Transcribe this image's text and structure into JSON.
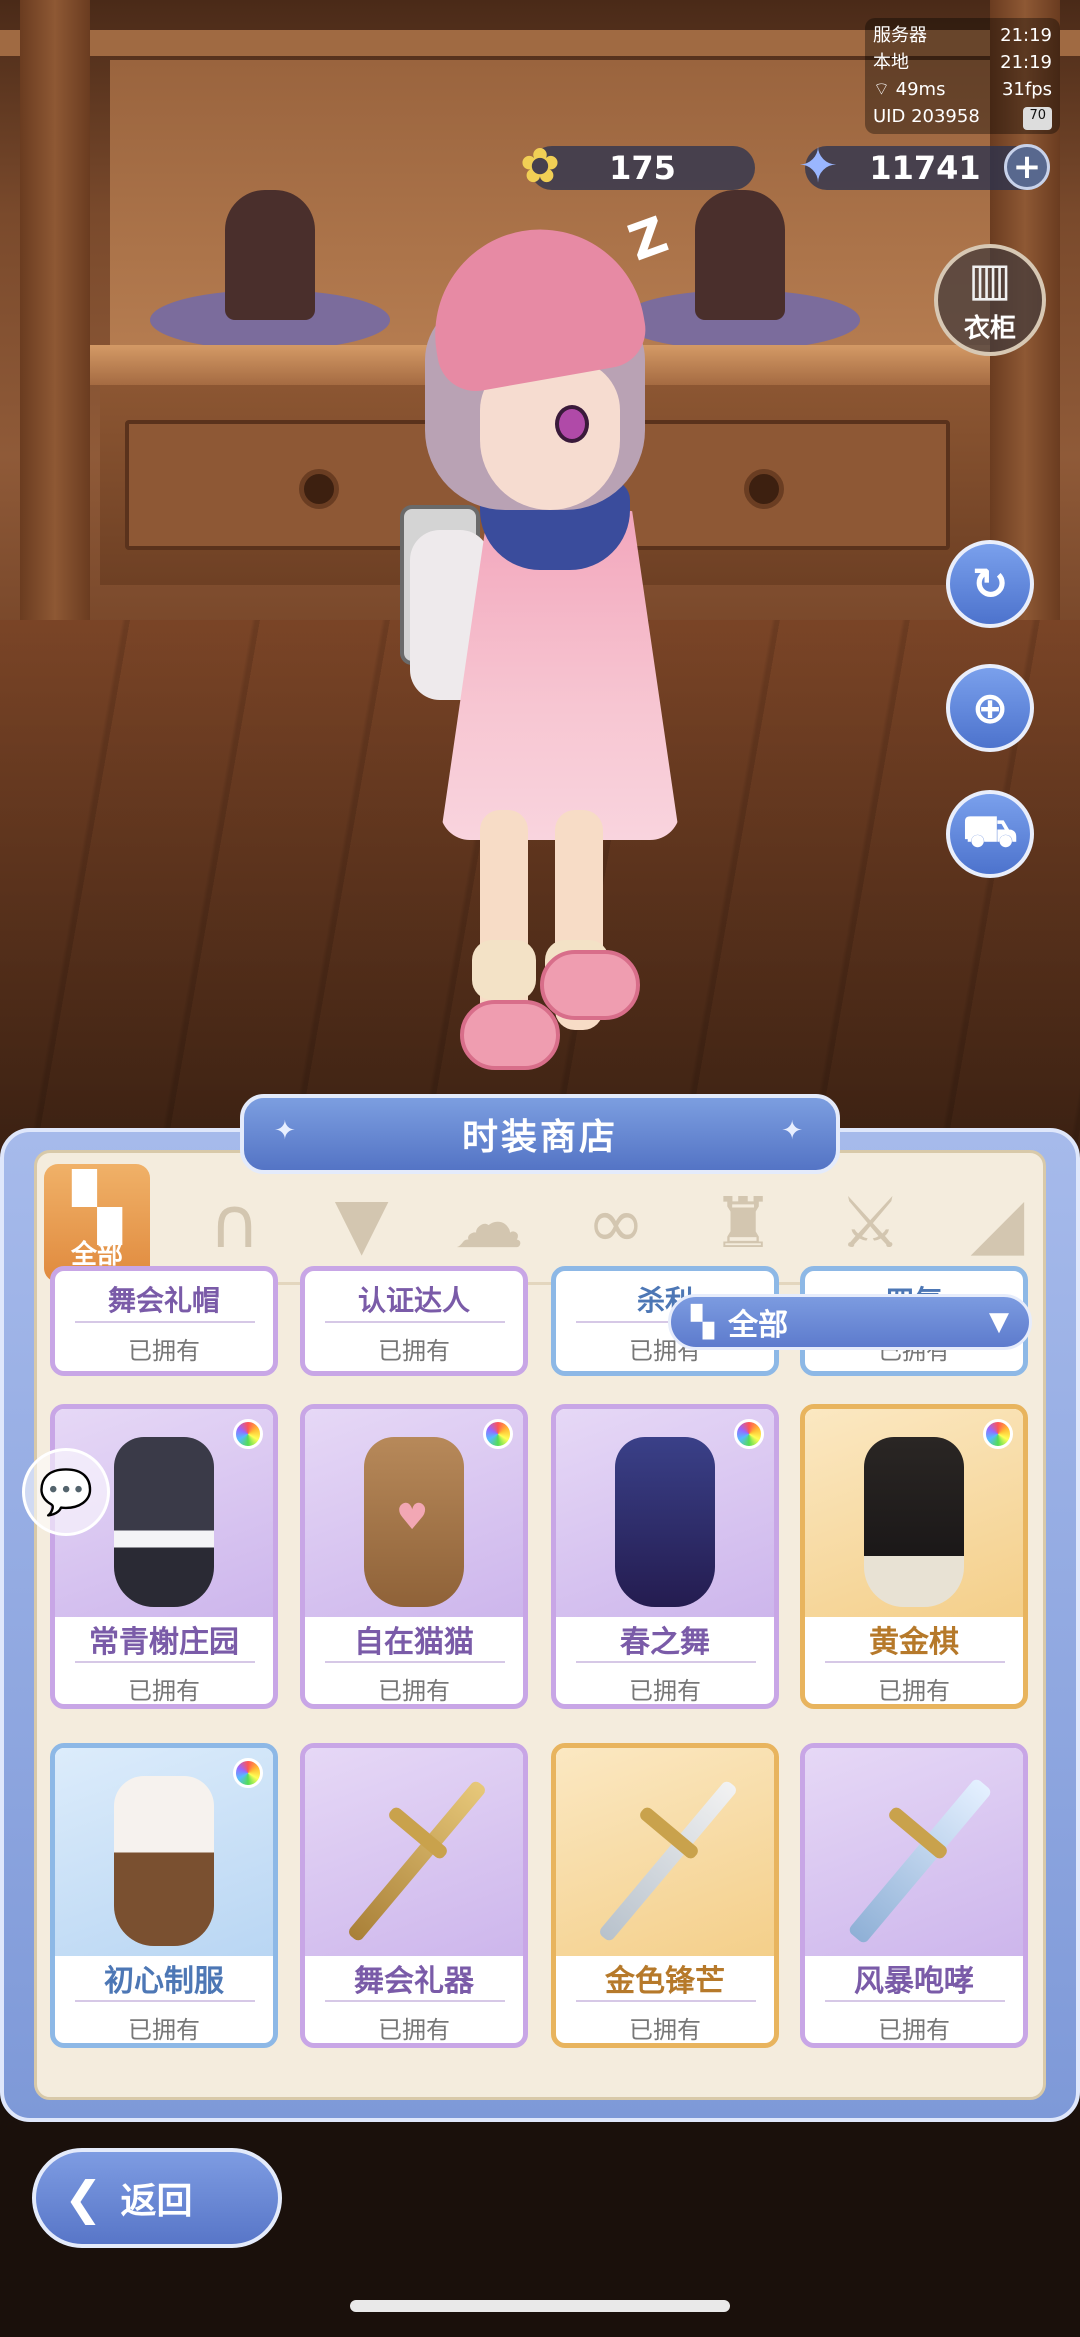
{
  "status": {
    "server_label": "服务器",
    "server_time": "21:19",
    "local_label": "本地",
    "local_time": "21:19",
    "ping": "49ms",
    "fps": "31fps",
    "uid": "UID 203958",
    "battery": "70"
  },
  "currency": {
    "gold_icon": "flower-coin-icon",
    "gold_value": "175",
    "star_icon": "star-crystal-icon",
    "star_value": "11741",
    "plus": "+"
  },
  "side": {
    "wardrobe_label": "衣柜",
    "rotate_icon": "rotate-icon",
    "zoom_icon": "zoom-in-icon",
    "cart_icon": "shopping-cart-icon"
  },
  "shop": {
    "title": "时装商店",
    "categories": [
      {
        "label": "全部",
        "icon": "grid-icon"
      },
      {
        "icon": "cat-ears-icon"
      },
      {
        "icon": "mask-icon"
      },
      {
        "icon": "hair-icon"
      },
      {
        "icon": "eye-mask-icon"
      },
      {
        "icon": "outfit-icon"
      },
      {
        "icon": "sword-icon"
      },
      {
        "icon": "wing-icon"
      }
    ],
    "filter_label": "全部",
    "partial_items": [
      {
        "name": "舞会礼帽",
        "status": "已拥有"
      },
      {
        "name": "认证达人",
        "status": "已拥有"
      },
      {
        "name": "杀利",
        "status": "已拥有"
      },
      {
        "name": "四气",
        "status": "已拥有"
      }
    ],
    "items_row1": [
      {
        "name": "常青榭庄园",
        "status": "已拥有"
      },
      {
        "name": "自在猫猫",
        "status": "已拥有"
      },
      {
        "name": "春之舞",
        "status": "已拥有"
      },
      {
        "name": "黄金棋",
        "status": "已拥有"
      }
    ],
    "items_row2": [
      {
        "name": "初心制服",
        "status": "已拥有"
      },
      {
        "name": "舞会礼器",
        "status": "已拥有"
      },
      {
        "name": "金色锋芒",
        "status": "已拥有"
      },
      {
        "name": "风暴咆哮",
        "status": "已拥有"
      }
    ]
  },
  "back_label": "返回",
  "colors": {
    "panel": "#7e99d8",
    "panel_inner": "#f4ecdd",
    "accent_orange": "#e08a3e",
    "purple_border": "#c8a6e6",
    "gold_border": "#e8b45e",
    "blue_border": "#8db8e6"
  }
}
